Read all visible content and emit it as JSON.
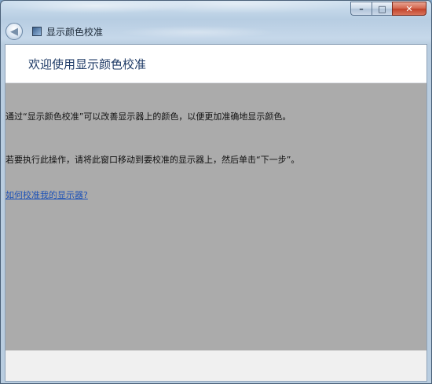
{
  "window": {
    "title": "显示颜色校准"
  },
  "caption": {
    "minimize": "–",
    "maximize": "□",
    "close": "✕"
  },
  "nav": {
    "back": "◀"
  },
  "page": {
    "heading": "欢迎使用显示颜色校准",
    "paragraph1": "通过“显示颜色校准”可以改善显示器上的颜色，以便更加准确地显示颜色。",
    "paragraph2": "若要执行此操作，请将此窗口移动到要校准的显示器上，然后单击“下一步”。",
    "help_link": "如何校准我的显示器?"
  },
  "icons": {
    "back": "back-arrow-icon",
    "app": "color-calibration-icon"
  }
}
